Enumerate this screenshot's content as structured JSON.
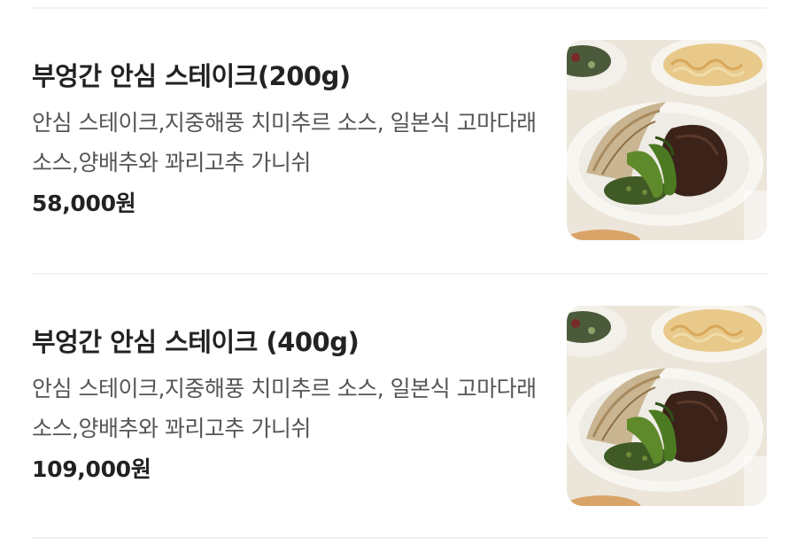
{
  "menu": {
    "items": [
      {
        "name": "부엉간 안심 스테이크(200g)",
        "description": "안심 스테이크,지중해풍 치미추르 소스, 일본식 고마다래 소스,양배추와 꽈리고추 가니쉬",
        "price": "58,000원",
        "image_icon": "steak-photo-icon"
      },
      {
        "name": "부엉간 안심 스테이크 (400g)",
        "description": "안심 스테이크,지중해풍 치미추르 소스, 일본식 고마다래 소스,양배추와 꽈리고추 가니쉬",
        "price": "109,000원",
        "image_icon": "steak-photo-icon"
      }
    ]
  }
}
